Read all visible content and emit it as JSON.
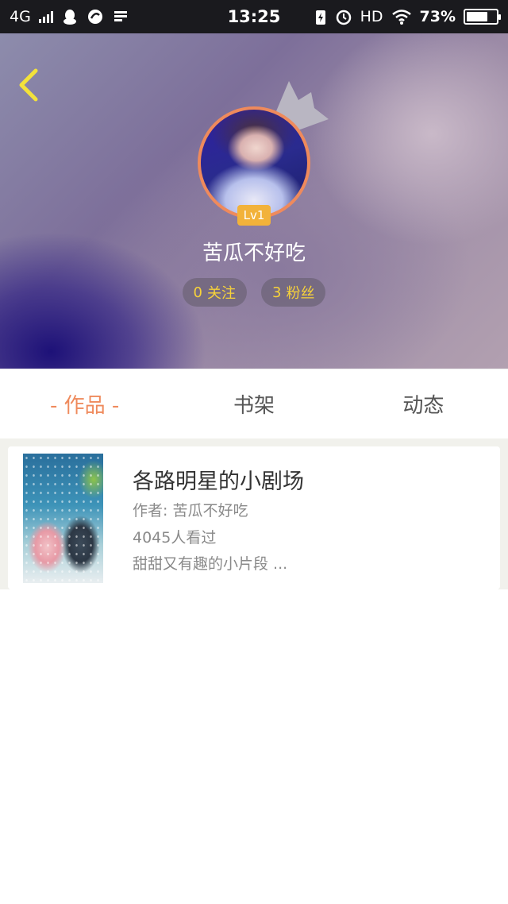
{
  "status_bar": {
    "network": "4G",
    "time": "13:25",
    "hd_label": "HD",
    "battery_percent": "73%",
    "battery_level": 0.73
  },
  "header": {
    "level": "Lv1",
    "username": "苦瓜不好吃",
    "following_count": "0",
    "following_label": "关注",
    "followers_count": "3",
    "followers_label": "粉丝"
  },
  "tabs": [
    {
      "label": "- 作品 -",
      "active": true
    },
    {
      "label": "书架",
      "active": false
    },
    {
      "label": "动态",
      "active": false
    }
  ],
  "works": [
    {
      "title": "各路明星的小剧场",
      "author": "作者: 苦瓜不好吃",
      "views": "4045人看过",
      "description": "甜甜又有趣的小片段 ..."
    }
  ],
  "colors": {
    "accent": "#ef8a5c",
    "badge": "#f2b23a",
    "stat_text": "#f7d23a"
  }
}
